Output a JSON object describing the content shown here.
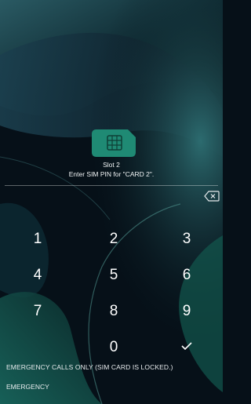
{
  "colors": {
    "background": "#061018",
    "sim_icon": "#1f8a74",
    "accent_green": "#1d6b5c"
  },
  "sim": {
    "icon": "sim-card-icon",
    "slot_label": "Slot 2",
    "prompt": "Enter SIM PIN for \"CARD 2\"."
  },
  "pin_entry": {
    "value": "",
    "backspace_icon": "backspace-icon"
  },
  "keypad": {
    "keys": [
      "1",
      "2",
      "3",
      "4",
      "5",
      "6",
      "7",
      "8",
      "9",
      "0"
    ],
    "ok_icon": "checkmark-icon"
  },
  "footer": {
    "status": "EMERGENCY CALLS ONLY (SIM CARD IS LOCKED.)",
    "emergency": "EMERGENCY"
  }
}
